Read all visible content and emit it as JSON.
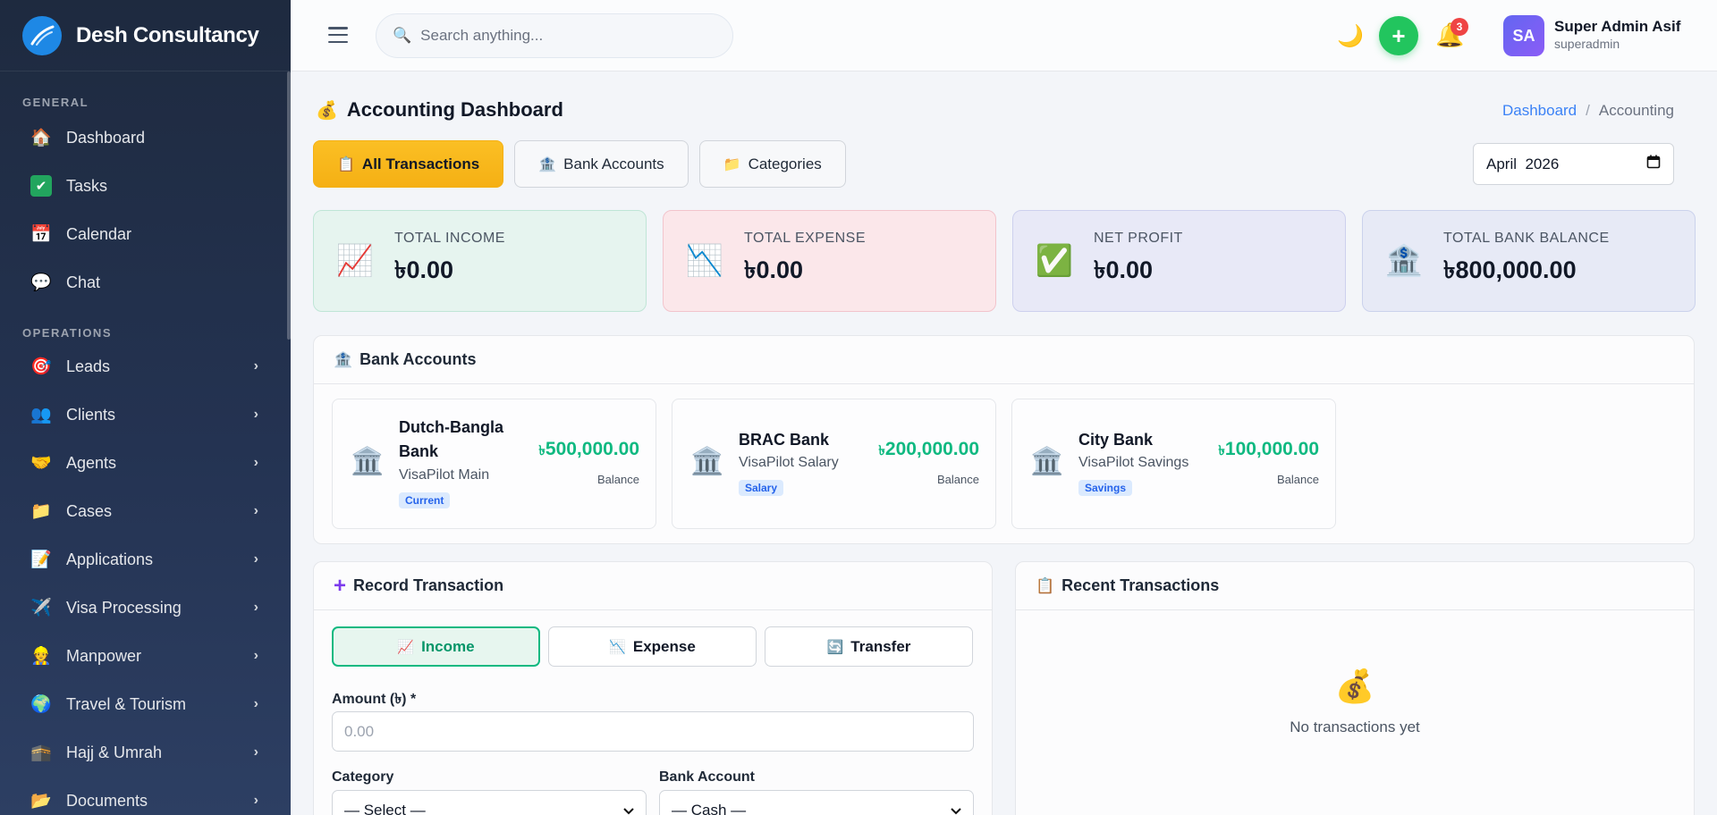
{
  "brand": {
    "name": "Desh Consultancy"
  },
  "sidebar": {
    "sections": [
      {
        "label": "GENERAL"
      },
      {
        "label": "OPERATIONS"
      }
    ],
    "items": [
      {
        "label": "Dashboard",
        "icon": "house-icon"
      },
      {
        "label": "Tasks",
        "icon": "check-icon"
      },
      {
        "label": "Calendar",
        "icon": "calendar-icon"
      },
      {
        "label": "Chat",
        "icon": "speech-bubble-icon"
      },
      {
        "label": "Leads",
        "icon": "target-icon"
      },
      {
        "label": "Clients",
        "icon": "users-icon"
      },
      {
        "label": "Agents",
        "icon": "handshake-icon"
      },
      {
        "label": "Cases",
        "icon": "folder-icon"
      },
      {
        "label": "Applications",
        "icon": "document-icon"
      },
      {
        "label": "Visa Processing",
        "icon": "airplane-icon"
      },
      {
        "label": "Manpower",
        "icon": "worker-icon"
      },
      {
        "label": "Travel & Tourism",
        "icon": "globe-icon"
      },
      {
        "label": "Hajj & Umrah",
        "icon": "kaaba-icon"
      },
      {
        "label": "Documents",
        "icon": "folder-icon"
      }
    ]
  },
  "topbar": {
    "search_placeholder": "Search anything...",
    "notification_count": "3",
    "user_initials": "SA",
    "user_name": "Super Admin Asif",
    "user_role": "superadmin"
  },
  "page": {
    "title": "Accounting Dashboard",
    "breadcrumb": [
      "Dashboard",
      "Accounting"
    ],
    "tabs": [
      "All Transactions",
      "Bank Accounts",
      "Categories"
    ],
    "month": "April  2026"
  },
  "stats": [
    {
      "label": "TOTAL INCOME",
      "value": "৳0.00",
      "icon": "chart-increasing-icon",
      "bg": "#e6f4ef",
      "border": "#bfe5d6"
    },
    {
      "label": "TOTAL EXPENSE",
      "value": "৳0.00",
      "icon": "chart-decreasing-icon",
      "bg": "#fbe7ea",
      "border": "#f2c4cc"
    },
    {
      "label": "NET PROFIT",
      "value": "৳0.00",
      "icon": "check-mark-icon",
      "bg": "#e8e9f7",
      "border": "#cdd0ee"
    },
    {
      "label": "TOTAL BANK BALANCE",
      "value": "৳800,000.00",
      "icon": "bank-icon",
      "bg": "#e7eaf6",
      "border": "#cbd2ec"
    }
  ],
  "bank_accounts": {
    "title": "Bank Accounts",
    "balance_label": "Balance",
    "items": [
      {
        "name": "Dutch-Bangla Bank",
        "subtitle": "VisaPilot Main",
        "tag": "Current",
        "balance": "500,000.00",
        "currency": "৳"
      },
      {
        "name": "BRAC Bank",
        "subtitle": "VisaPilot Salary",
        "tag": "Salary",
        "balance": "200,000.00",
        "currency": "৳"
      },
      {
        "name": "City Bank",
        "subtitle": "VisaPilot Savings",
        "tag": "Savings",
        "balance": "100,000.00",
        "currency": "৳"
      }
    ]
  },
  "record_transaction": {
    "title": "Record Transaction",
    "types": [
      "Income",
      "Expense",
      "Transfer"
    ],
    "amount_label": "Amount (৳) *",
    "amount_placeholder": "0.00",
    "category_label": "Category",
    "category_value": "— Select —",
    "bank_label": "Bank Account",
    "bank_value": "— Cash —"
  },
  "recent_transactions": {
    "title": "Recent Transactions",
    "empty_text": "No transactions yet"
  }
}
